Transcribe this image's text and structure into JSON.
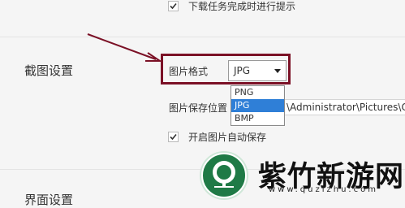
{
  "download": {
    "notify_label": "下载任务完成时进行提示",
    "notify_checked": true
  },
  "screenshot_settings": {
    "section_title": "截图设置",
    "format_label": "图片格式",
    "format_selected": "JPG",
    "format_options": [
      "PNG",
      "JPG",
      "BMP"
    ],
    "save_location_label": "图片保存位置",
    "save_path_visible": "\\Administrator\\Pictures\\C",
    "auto_save_label": "开启图片自动保存",
    "auto_save_checked": true
  },
  "next_section": {
    "title_partial": "界面设置"
  },
  "watermark": {
    "brand": "紫竹新游网",
    "url": "www.quzizhu.com"
  },
  "colors": {
    "highlight_border": "#7b1126",
    "selected_option_bg": "#2f7fd7",
    "logo_green": "#1f7a46"
  }
}
